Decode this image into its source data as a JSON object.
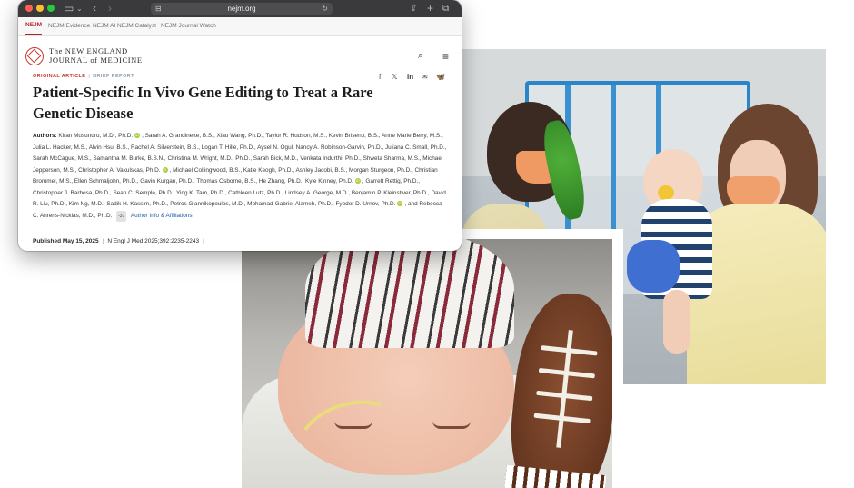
{
  "browser": {
    "url": "nejm.org",
    "colors": {
      "titlebar": "#3a3a3c",
      "close": "#ff5f57",
      "minimize": "#febc2e",
      "zoom": "#28c840"
    }
  },
  "nav": {
    "items": [
      "NEJM",
      "NEJM Evidence",
      "NEJM AI",
      "NEJM Catalyst",
      "NEJM Journal Watch"
    ]
  },
  "masthead": {
    "line1": "The NEW ENGLAND",
    "line2": "JOURNAL of MEDICINE"
  },
  "article": {
    "type": "ORIGINAL ARTICLE",
    "subtype": "BRIEF REPORT",
    "share_icons": [
      "f",
      "𝕏",
      "in",
      "✉",
      "🦋"
    ],
    "title": "Patient-Specific In Vivo Gene Editing to Treat a Rare Genetic Disease",
    "authors_label": "Authors:",
    "authors_part1": "Kiran Musunuru, M.D., Ph.D.",
    "authors_part2": ", Sarah A. Grandinette, B.S., Xiao Wang, Ph.D., Taylor R. Hudson, M.S., Kevin Briseno, B.S., Anne Marie Berry, M.S., Julia L. Hacker, M.S., Alvin Hsu, B.S., Rachel A. Silverstein, B.S., Logan T. Hille, Ph.D., Aysel N. Ogul, Nancy A. Robinson-Garvin, Ph.D., Juliana C. Small, Ph.D., Sarah McCague, M.S., Samantha M. Burke, B.S.N., Christina M. Wright, M.D., Ph.D., Sarah Bick, M.D., Venkata Indurthi, Ph.D., Shweta Sharma, M.S., Michael Jepperson, M.S., Christopher A. Vakulskas, Ph.D.",
    "authors_part3": ", Michael Collingwood, B.S., Katie Keogh, Ph.D., Ashley Jacobi, B.S., Morgan Sturgeon, Ph.D., Christian Brommel, M.S., Ellen Schmaljohn, Ph.D., Gavin Kurgan, Ph.D., Thomas Osborne, B.S., He Zhang, Ph.D., Kyle Kinney, Ph.D.",
    "authors_part4": ", Garrett Rettig, Ph.D., Christopher J. Barbosa, Ph.D., Sean C. Semple, Ph.D., Ying K. Tam, Ph.D., Cathleen Lutz, Ph.D., Lindsey A. George, M.D., Benjamin P. Kleinstiver, Ph.D., David R. Liu, Ph.D., Kim Ng, M.D., Sadik H. Kassim, Ph.D., Petros Giannikopoulos, M.D., Mohamad-Gabriel Alameh, Ph.D., Fyodor D. Urnov, Ph.D.",
    "authors_part5": ", and Rebecca C. Ahrens-Nicklas, M.D., Ph.D.",
    "more_badge": "-37",
    "author_info_link": "Author Info & Affiliations",
    "published": "Published May 15, 2025",
    "citation": "N Engl J Med 2025;392:2235-2243",
    "trailing_sep": "|"
  }
}
